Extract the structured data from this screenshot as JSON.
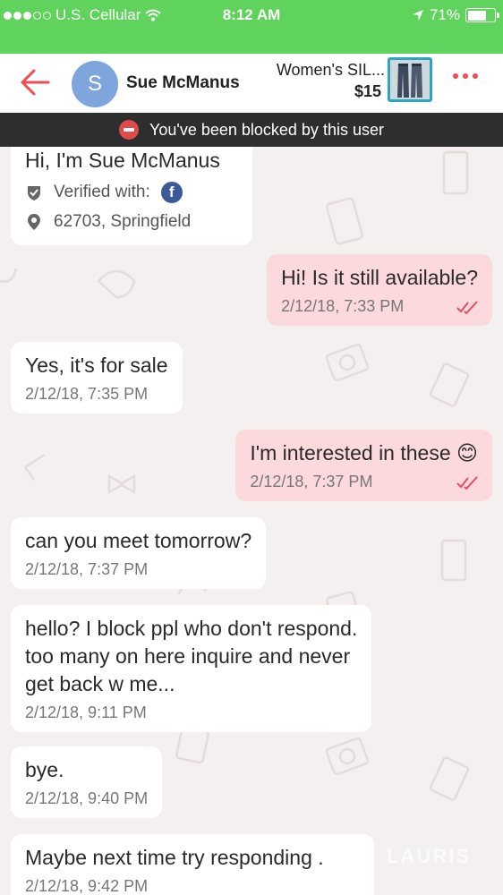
{
  "status_bar": {
    "carrier": "U.S. Cellular",
    "time": "8:12 AM",
    "battery": "71%",
    "battery_level": 0.71
  },
  "header": {
    "avatar_letter": "S",
    "username": "Sue McManus",
    "listing_title": "Women's SIL...",
    "listing_price": "$15",
    "colors": {
      "accent": "#f04a55",
      "status_green": "#5fd35c",
      "avatar_blue": "#7ea6dd"
    }
  },
  "blocked_banner": {
    "text": "You've been blocked by this user"
  },
  "profile": {
    "title": "Hi, I'm Sue McManus",
    "verified_label": "Verified with:",
    "verified_via": "f",
    "location": "62703, Springfield"
  },
  "messages": [
    {
      "direction": "out",
      "text": "Hi! Is it still available?",
      "time": "2/12/18, 7:33 PM"
    },
    {
      "direction": "in",
      "text": "Yes, it's for sale",
      "time": "2/12/18, 7:35 PM"
    },
    {
      "direction": "out",
      "text": "I'm interested in these 😊",
      "time": "2/12/18, 7:37 PM"
    },
    {
      "direction": "in",
      "text": "can you meet tomorrow?",
      "time": "2/12/18, 7:37 PM"
    },
    {
      "direction": "in",
      "text": "hello? I block ppl who don't respond.\ntoo many on here inquire and never\nget back w me...",
      "time": "2/12/18, 9:11 PM"
    },
    {
      "direction": "in",
      "text": "bye.",
      "time": "2/12/18, 9:40 PM"
    },
    {
      "direction": "in",
      "text": "Maybe next time try responding .",
      "time": "2/12/18, 9:42 PM"
    }
  ],
  "watermark": "LAURIS"
}
